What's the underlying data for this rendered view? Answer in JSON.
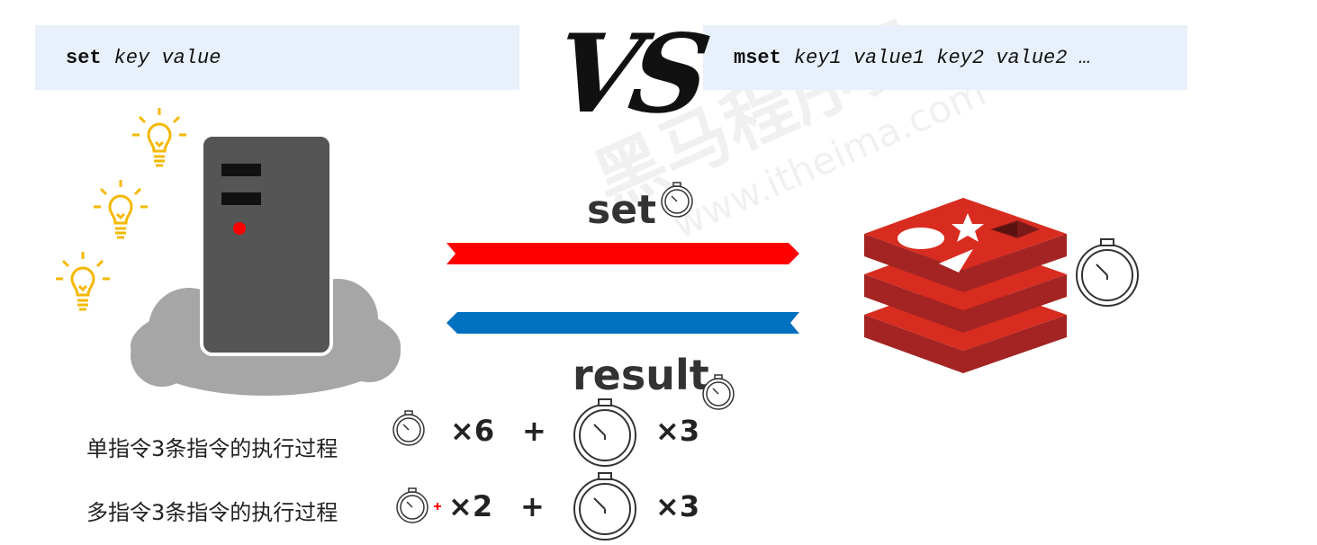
{
  "commands": {
    "single": {
      "keyword": "set",
      "args": "key value"
    },
    "multi": {
      "keyword": "mset",
      "args": "key1 value1 key2 value2 …"
    }
  },
  "vs_label": "VS",
  "flow": {
    "request_label": "set",
    "response_label": "result"
  },
  "rows": [
    {
      "label": "单指令3条指令的执行过程",
      "small_factor": "×6",
      "plus": "+",
      "large_factor": "×3"
    },
    {
      "label": "多指令3条指令的执行过程",
      "small_factor": "×2",
      "plus": "+",
      "large_factor": "×3"
    }
  ],
  "watermark": {
    "cn": "黑马程序员",
    "url": "www.itheima.com"
  },
  "colors": {
    "command_bg": "#e8f0fb",
    "request_arrow": "#ff0000",
    "response_arrow": "#0070c0",
    "redis_red": "#c9302c",
    "server_gray": "#555555",
    "cloud_gray": "#a6a6a6",
    "bulb_yellow": "#f5b800"
  },
  "icons": [
    "lightbulb-icon",
    "server-icon",
    "cloud-icon",
    "redis-logo-icon",
    "stopwatch-icon"
  ]
}
